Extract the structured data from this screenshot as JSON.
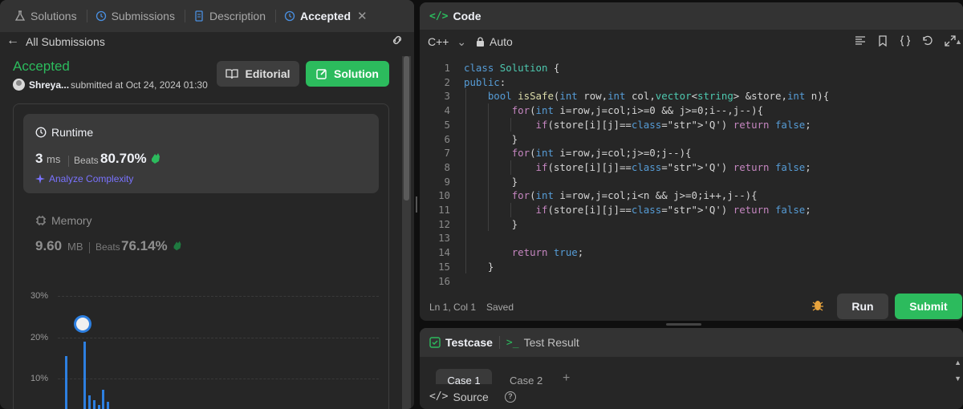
{
  "left": {
    "tabs": [
      {
        "label": "Solutions",
        "icon": "flask-icon"
      },
      {
        "label": "Submissions",
        "icon": "history-icon"
      },
      {
        "label": "Description",
        "icon": "document-icon"
      },
      {
        "label": "Accepted",
        "icon": "history-icon",
        "active": true
      }
    ],
    "back_label": "All Submissions",
    "status": "Accepted",
    "username": "Shreya...",
    "submitted": "submitted at Oct 24, 2024 01:30",
    "editorial_label": "Editorial",
    "solution_label": "Solution",
    "runtime": {
      "title": "Runtime",
      "value": "3",
      "unit": "ms",
      "beats_label": "Beats",
      "beats_value": "80.70%",
      "analyze": "Analyze Complexity"
    },
    "memory": {
      "title": "Memory",
      "value": "9.60",
      "unit": "MB",
      "beats_label": "Beats",
      "beats_value": "76.14%"
    },
    "chart_data": {
      "type": "bar",
      "ylim": [
        0,
        30
      ],
      "y_ticks": [
        "30%",
        "20%",
        "10%"
      ],
      "values": [
        15.4,
        0,
        0,
        0.4,
        18.8,
        5.9,
        4.6,
        3.6,
        7.2,
        4.2
      ],
      "highlight_index": 4
    }
  },
  "editor": {
    "title": "Code",
    "language": "C++",
    "mode": "Auto",
    "status": "Ln 1, Col 1",
    "saved": "Saved",
    "run_label": "Run",
    "submit_label": "Submit",
    "lines": [
      "class Solution {",
      "public:",
      "    bool isSafe(int row,int col,vector<string> &store,int n){",
      "        for(int i=row,j=col;i>=0 && j>=0;i--,j--){",
      "            if(store[i][j]=='Q') return false;",
      "        }",
      "        for(int i=row,j=col;j>=0;j--){",
      "            if(store[i][j]=='Q') return false;",
      "        }",
      "        for(int i=row,j=col;i<n && j>=0;i++,j--){",
      "            if(store[i][j]=='Q') return false;",
      "        }",
      "",
      "        return true;",
      "    }",
      ""
    ]
  },
  "testpanel": {
    "testcase_label": "Testcase",
    "result_label": "Test Result",
    "case1": "Case 1",
    "case2": "Case 2",
    "source_label": "Source"
  },
  "colors": {
    "accent_green": "#2cbb5d",
    "bar_blue": "#2d7fe0",
    "panel_bg": "#262626"
  }
}
